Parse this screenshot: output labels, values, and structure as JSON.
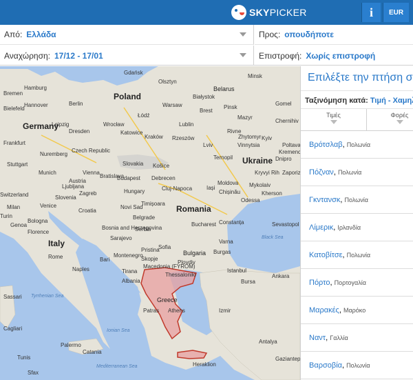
{
  "header": {
    "brand_bold": "SKY",
    "brand_light": "PICKER",
    "info_label": "i",
    "currency": "EUR"
  },
  "search": {
    "from_label": "Από:",
    "from_value": "Ελλάδα",
    "to_label": "Προς:",
    "to_value": "οπουδήποτε",
    "depart_label": "Αναχώρηση:",
    "depart_value": "17/12 - 17/01",
    "return_label": "Επιστροφή:",
    "return_value": "Χωρίς επιστροφή"
  },
  "map": {
    "countries": [
      "Poland",
      "Belarus",
      "Germany",
      "Ukraine",
      "Romania",
      "Italy",
      "Bulgaria",
      "Greece",
      "Hungary",
      "Czech Republic",
      "Slovakia",
      "Moldova",
      "Austria",
      "Switzerland",
      "Serbia",
      "Croatia",
      "Bosnia and Herzegovina",
      "Macedonia (FYROM)",
      "Albania",
      "Slovenia",
      "Montenegro"
    ],
    "cities": [
      "Hamburg",
      "Bremen",
      "Berlin",
      "Hannover",
      "Bielefeld",
      "Leipzig",
      "Dresden",
      "Frankfurt",
      "Nuremberg",
      "Stuttgart",
      "Munich",
      "Gdańsk",
      "Olsztyn",
      "Białystok",
      "Warsaw",
      "Łódź",
      "Lublin",
      "Wrocław",
      "Kraków",
      "Katowice",
      "Rzeszów",
      "Lviv",
      "Rivne",
      "Ternopil",
      "Minsk",
      "Gomel",
      "Pinsk",
      "Brest",
      "Vienna",
      "Bratislava",
      "Budapest",
      "Košice",
      "Debrecen",
      "Cluj-Napoca",
      "Iași",
      "Chișinău",
      "Odessa",
      "Bucharest",
      "Constanța",
      "Belgrade",
      "Novi Sad",
      "Timișoara",
      "Zagreb",
      "Ljubljana",
      "Milan",
      "Venice",
      "Turin",
      "Genoa",
      "Bologna",
      "Florence",
      "Rome",
      "Naples",
      "Bari",
      "Sarajevo",
      "Sofia",
      "Plovdiv",
      "Varna",
      "Burgas",
      "Skopje",
      "Thessaloniki",
      "Athens",
      "Patras",
      "Palermo",
      "Catania",
      "Cagliari",
      "Sassari",
      "Istanbul",
      "Izmir",
      "Bursa",
      "Ankara",
      "Antalya",
      "Kyiv",
      "Kryvyi Rih",
      "Zaporizhia",
      "Dnipro",
      "Kherson",
      "Mykolaiv",
      "Sevastopol",
      "Tunis",
      "Sfax",
      "Tirana",
      "Heraklion",
      "Pristina",
      "Vinnytsia",
      "Chernihiv",
      "Mazyr",
      "Zhytomyr",
      "Poltava",
      "Kremenchuk",
      "Gaziantep"
    ],
    "seas": [
      "Tyrrhenian Sea",
      "Ionian Sea",
      "Mediterranean Sea",
      "Black Sea"
    ]
  },
  "results": {
    "title": "Επιλέξτε την πτήση σας",
    "sort_label": "Ταξινόμηση κατά:",
    "sort_value": "Τιμή - Χαμηλότερη",
    "tabs": [
      {
        "label": "Τιμές"
      },
      {
        "label": "Φορές"
      }
    ],
    "items": [
      {
        "city": "Βρότσλαβ",
        "country": "Πολωνία"
      },
      {
        "city": "Πόζναν",
        "country": "Πολωνία"
      },
      {
        "city": "Γκντανσκ",
        "country": "Πολωνία"
      },
      {
        "city": "Λίμερικ",
        "country": "Ιρλανδία"
      },
      {
        "city": "Κατοβίτσε",
        "country": "Πολωνία"
      },
      {
        "city": "Πόρτο",
        "country": "Πορτογαλία"
      },
      {
        "city": "Μαρακές",
        "country": "Μαρόκο"
      },
      {
        "city": "Ναντ",
        "country": "Γαλλία"
      },
      {
        "city": "Βαρσοβία",
        "country": "Πολωνία"
      }
    ]
  },
  "colors": {
    "header_bg": "#1f6db3",
    "link_blue": "#2a79c9",
    "sea_blue": "#a8c6eb",
    "land": "#e6e3d9",
    "highlight_fill": "#e8a0a0",
    "highlight_border": "#c0392b"
  }
}
